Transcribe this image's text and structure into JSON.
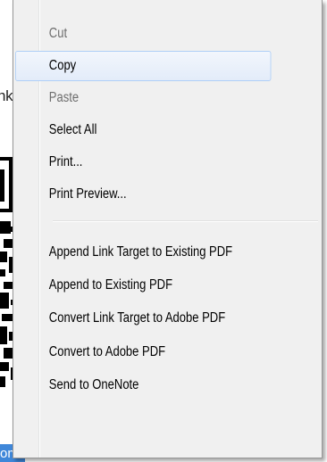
{
  "background": {
    "text_fragment": "nk",
    "bottom_fragment": "om"
  },
  "menu": {
    "items": [
      {
        "label": "Cut",
        "enabled": false,
        "highlighted": false
      },
      {
        "label": "Copy",
        "enabled": true,
        "highlighted": true
      },
      {
        "label": "Paste",
        "enabled": false,
        "highlighted": false
      },
      {
        "label": "Select All",
        "enabled": true,
        "highlighted": false
      },
      {
        "label": "Print...",
        "enabled": true,
        "highlighted": false
      },
      {
        "label": "Print Preview...",
        "enabled": true,
        "highlighted": false
      },
      {
        "label": "Append Link Target to Existing PDF",
        "enabled": true,
        "highlighted": false
      },
      {
        "label": "Append to Existing PDF",
        "enabled": true,
        "highlighted": false
      },
      {
        "label": "Convert Link Target to Adobe PDF",
        "enabled": true,
        "highlighted": false
      },
      {
        "label": "Convert to Adobe PDF",
        "enabled": true,
        "highlighted": false
      },
      {
        "label": "Send to OneNote",
        "enabled": true,
        "highlighted": false
      }
    ]
  },
  "colors": {
    "menu_bg": "#f0f0f0",
    "highlight_border": "#aecff7",
    "disabled_text": "#6d6d6d",
    "strip_blue": "#3f87d9"
  }
}
